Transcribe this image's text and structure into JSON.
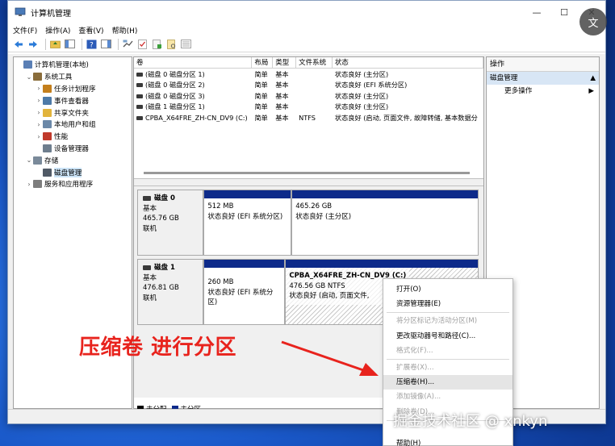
{
  "window": {
    "title": "计算机管理",
    "controls": {
      "minimize": "—",
      "maximize": "☐",
      "close": "✕"
    }
  },
  "menubar": [
    "文件(F)",
    "操作(A)",
    "查看(V)",
    "帮助(H)"
  ],
  "tree": {
    "items": [
      {
        "label": "计算机管理(本地)",
        "indent": 0,
        "arrow": "",
        "icon": "computer-icon",
        "color": "#5a7fb5"
      },
      {
        "label": "系统工具",
        "indent": 1,
        "arrow": "⌄",
        "icon": "tools-icon",
        "color": "#8a6d3b"
      },
      {
        "label": "任务计划程序",
        "indent": 2,
        "arrow": "›",
        "icon": "clock-icon",
        "color": "#c47f1c"
      },
      {
        "label": "事件查看器",
        "indent": 2,
        "arrow": "›",
        "icon": "event-icon",
        "color": "#4d7aa8"
      },
      {
        "label": "共享文件夹",
        "indent": 2,
        "arrow": "›",
        "icon": "folder-icon",
        "color": "#e2b43c"
      },
      {
        "label": "本地用户和组",
        "indent": 2,
        "arrow": "›",
        "icon": "users-icon",
        "color": "#6b88a8"
      },
      {
        "label": "性能",
        "indent": 2,
        "arrow": "›",
        "icon": "performance-icon",
        "color": "#c0392b"
      },
      {
        "label": "设备管理器",
        "indent": 2,
        "arrow": "",
        "icon": "device-icon",
        "color": "#6e7e8e"
      },
      {
        "label": "存储",
        "indent": 1,
        "arrow": "⌄",
        "icon": "storage-icon",
        "color": "#7a8a9a"
      },
      {
        "label": "磁盘管理",
        "indent": 2,
        "arrow": "",
        "icon": "disk-icon",
        "color": "#505a66",
        "selected": true
      },
      {
        "label": "服务和应用程序",
        "indent": 1,
        "arrow": "›",
        "icon": "services-icon",
        "color": "#7d7d7d"
      }
    ]
  },
  "volume_table": {
    "headers": [
      "卷",
      "布局",
      "类型",
      "文件系统",
      "状态"
    ],
    "rows": [
      [
        "(磁盘 0 磁盘分区 1)",
        "简单",
        "基本",
        "",
        "状态良好 (主分区)"
      ],
      [
        "(磁盘 0 磁盘分区 2)",
        "简单",
        "基本",
        "",
        "状态良好 (EFI 系统分区)"
      ],
      [
        "(磁盘 0 磁盘分区 3)",
        "简单",
        "基本",
        "",
        "状态良好 (主分区)"
      ],
      [
        "(磁盘 1 磁盘分区 1)",
        "简单",
        "基本",
        "",
        "状态良好 (主分区)"
      ],
      [
        "CPBA_X64FRE_ZH-CN_DV9 (C:)",
        "简单",
        "基本",
        "NTFS",
        "状态良好 (启动, 页面文件, 故障转储, 基本数据分"
      ]
    ]
  },
  "disks": [
    {
      "name": "磁盘 0",
      "type": "基本",
      "size": "465.76 GB",
      "status": "联机",
      "partitions": [
        {
          "line1": "",
          "line2": "512 MB",
          "line3": "状态良好 (EFI 系统分区)",
          "hatched": false
        },
        {
          "line1": "",
          "line2": "465.26 GB",
          "line3": "状态良好 (主分区)",
          "hatched": false
        }
      ]
    },
    {
      "name": "磁盘 1",
      "type": "基本",
      "size": "476.81 GB",
      "status": "联机",
      "partitions": [
        {
          "line1": "",
          "line2": "260 MB",
          "line3": "状态良好 (EFI 系统分区)",
          "hatched": false
        },
        {
          "line1": "CPBA_X64FRE_ZH-CN_DV9  (C:)",
          "line2": "476.56 GB NTFS",
          "line3": "状态良好 (启动, 页面文件,",
          "hatched": true
        }
      ]
    }
  ],
  "legend": [
    {
      "label": "未分配",
      "color": "#000000"
    },
    {
      "label": "主分区",
      "color": "#0d2a8a"
    }
  ],
  "actions": {
    "header": "操作",
    "section": "磁盘管理",
    "items": [
      "更多操作"
    ]
  },
  "context_menu": [
    {
      "label": "打开(O)",
      "disabled": false
    },
    {
      "label": "资源管理器(E)",
      "disabled": false
    },
    {
      "sep": true
    },
    {
      "label": "将分区标记为活动分区(M)",
      "disabled": true
    },
    {
      "label": "更改驱动器号和路径(C)...",
      "disabled": false
    },
    {
      "label": "格式化(F)...",
      "disabled": true
    },
    {
      "sep": true
    },
    {
      "label": "扩展卷(X)...",
      "disabled": true
    },
    {
      "label": "压缩卷(H)...",
      "disabled": false,
      "highlighted": true
    },
    {
      "label": "添加镜像(A)...",
      "disabled": true
    },
    {
      "label": "删除卷(D)...",
      "disabled": true
    },
    {
      "sep": true
    },
    {
      "label": "",
      "disabled": true
    },
    {
      "label": "帮助(H)",
      "disabled": false
    }
  ],
  "annotation": "压缩卷 进行分区",
  "watermark": "掘金技术社区 @ xnkyn",
  "float_button": "文",
  "colors": {
    "primary_partition": "#0d2a8a",
    "annotation_red": "#e8231d",
    "selection": "#cce4f7"
  }
}
